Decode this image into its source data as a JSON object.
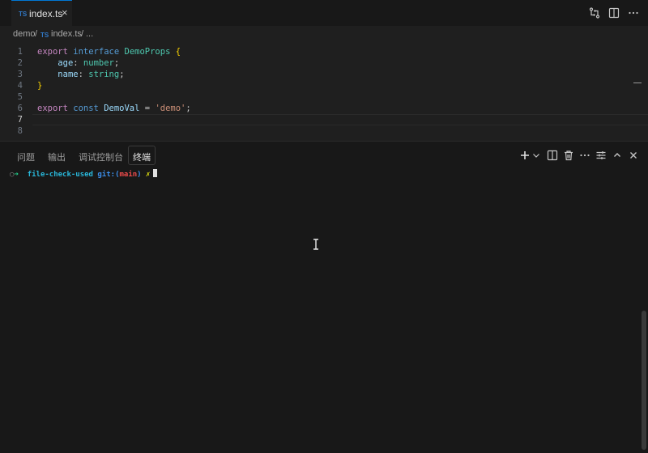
{
  "tab": {
    "icon": "TS",
    "name": "index.ts",
    "close": "×"
  },
  "tab_actions": [
    "compare-changes-icon",
    "split-editor-icon",
    "more-actions-icon"
  ],
  "breadcrumb": {
    "folder": "demo",
    "sep1": "/",
    "icon": "TS",
    "file": "index.ts",
    "sep2": "/",
    "more": "..."
  },
  "editor": {
    "line_numbers": [
      "1",
      "2",
      "3",
      "4",
      "5",
      "6",
      "7",
      "8"
    ],
    "active_line": "7",
    "lines": {
      "l1": {
        "kw": "export",
        "kw2": "interface",
        "name": "DemoProps",
        "brace": "{"
      },
      "l2": {
        "prop": "age",
        "colon": ":",
        "type": "number",
        "semi": ";"
      },
      "l3": {
        "prop": "name",
        "colon": ":",
        "type": "string",
        "semi": ";"
      },
      "l4": {
        "brace": "}"
      },
      "l6": {
        "kw": "export",
        "kw2": "const",
        "name": "DemoVal",
        "eq": "=",
        "str": "'demo'",
        "semi": ";"
      }
    }
  },
  "panel": {
    "tabs": [
      "问题",
      "输出",
      "调试控制台",
      "终端"
    ],
    "active_tab": "终端",
    "actions": [
      "plus-icon",
      "chevron-down-icon",
      "split-terminal-icon",
      "trash-icon",
      "more-icon",
      "settings-sliders-icon",
      "chevron-up-icon",
      "close-icon"
    ]
  },
  "terminal": {
    "dot": "○",
    "arrow": "➜",
    "dir": "file-check-used",
    "git": "git:(",
    "branch": "main",
    "git_close": ")",
    "dirty": "✗"
  },
  "colors": {
    "accent": "#0078d4",
    "ts": "#3178c6",
    "bg": "#181818",
    "editor_bg": "#1f1f1f"
  }
}
